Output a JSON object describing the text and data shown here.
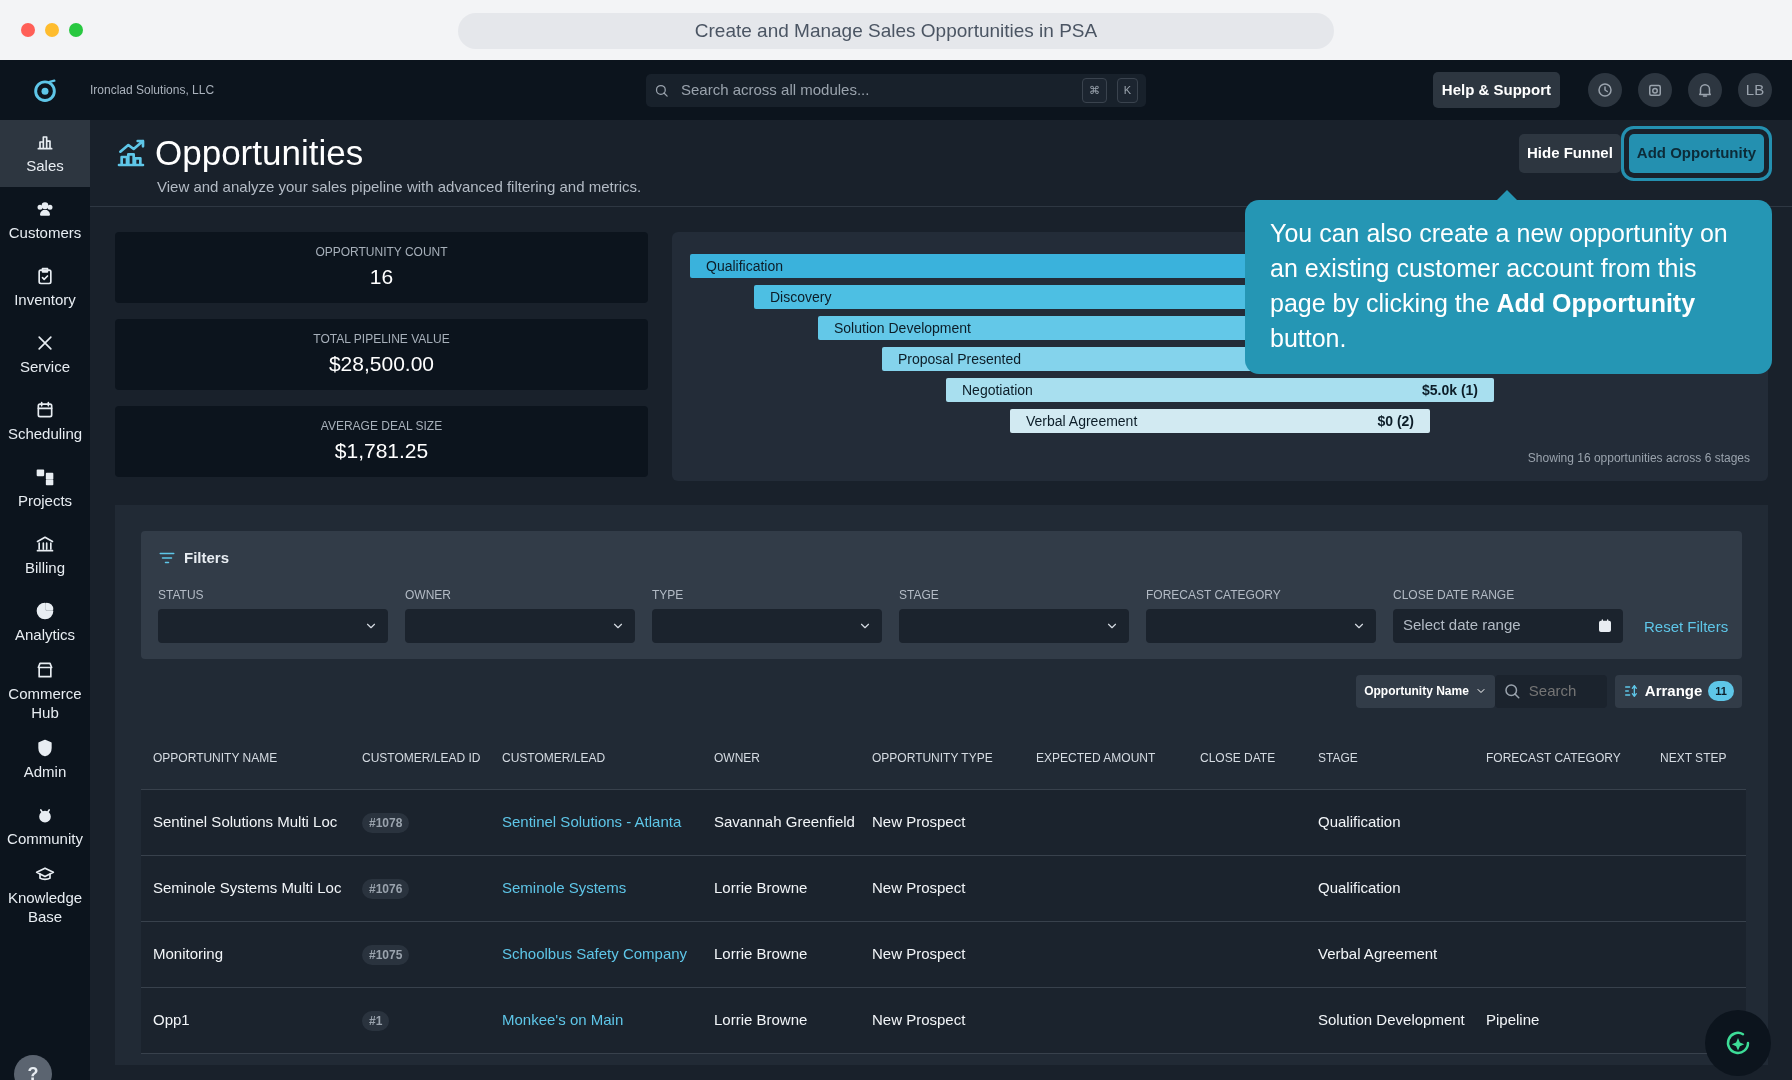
{
  "window": {
    "title": "Create and Manage Sales Opportunities in PSA"
  },
  "topbar": {
    "company": "Ironclad Solutions, LLC",
    "search_placeholder": "Search across all modules...",
    "shortcut_keys": [
      "⌘",
      "K"
    ],
    "help": "Help & Support",
    "avatar": "LB"
  },
  "sidebar": {
    "items": [
      {
        "label": "Sales",
        "selected": true
      },
      {
        "label": "Customers",
        "selected": false
      },
      {
        "label": "Inventory",
        "selected": false
      },
      {
        "label": "Service",
        "selected": false
      },
      {
        "label": "Scheduling",
        "selected": false
      },
      {
        "label": "Projects",
        "selected": false
      },
      {
        "label": "Billing",
        "selected": false
      },
      {
        "label": "Analytics",
        "selected": false
      },
      {
        "label": "Commerce Hub",
        "selected": false
      },
      {
        "label": "Admin",
        "selected": false
      },
      {
        "label": "Community",
        "selected": false
      },
      {
        "label": "Knowledge Base",
        "selected": false
      }
    ],
    "help_button": "?"
  },
  "header": {
    "title": "Opportunities",
    "subtitle": "View and analyze your sales pipeline with advanced filtering and metrics.",
    "buttons": [
      {
        "label": "Hide Funnel",
        "highlighted": false,
        "kind": "secondary"
      },
      {
        "label": "Add Opportunity",
        "highlighted": true,
        "kind": "primary"
      }
    ]
  },
  "stats": [
    {
      "label": "OPPORTUNITY COUNT",
      "value": "16"
    },
    {
      "label": "TOTAL PIPELINE VALUE",
      "value": "$28,500.00"
    },
    {
      "label": "AVERAGE DEAL SIZE",
      "value": "$1,781.25"
    }
  ],
  "funnel": {
    "stages": [
      {
        "label": "Qualification",
        "color": "#3ab2dc"
      },
      {
        "label": "Discovery",
        "color": "#4dbfe3"
      },
      {
        "label": "Solution Development",
        "color": "#63c8e8"
      },
      {
        "label": "Proposal Presented",
        "color": "#84d3ec"
      },
      {
        "label": "Negotiation",
        "value": "$5.0k (1)",
        "color": "#a8dfef"
      },
      {
        "label": "Verbal Agreement",
        "value": "$0 (2)",
        "color": "#d2eaf2"
      }
    ],
    "footer": "Showing 16 opportunities across 6 stages"
  },
  "tooltip": {
    "text": "You can also create a new opportunity on an existing customer account from this page by clicking the **Add Opportunity** button."
  },
  "filters": {
    "title": "Filters",
    "fields": [
      {
        "label": "STATUS",
        "kind": "select"
      },
      {
        "label": "OWNER",
        "kind": "select"
      },
      {
        "label": "TYPE",
        "kind": "select"
      },
      {
        "label": "STAGE",
        "kind": "select"
      },
      {
        "label": "FORECAST CATEGORY",
        "kind": "select"
      },
      {
        "label": "CLOSE DATE RANGE",
        "kind": "date",
        "placeholder": "Select date range"
      }
    ],
    "reset": "Reset Filters"
  },
  "table_toolbar": {
    "sort_field": "Opportunity Name",
    "search_placeholder": "Search",
    "arrange": "Arrange",
    "arrange_count": "11"
  },
  "table": {
    "columns": [
      "OPPORTUNITY NAME",
      "CUSTOMER/LEAD ID",
      "CUSTOMER/LEAD",
      "OWNER",
      "OPPORTUNITY TYPE",
      "EXPECTED AMOUNT",
      "CLOSE DATE",
      "STAGE",
      "FORECAST CATEGORY",
      "NEXT STEP"
    ],
    "rows": [
      {
        "name": "Sentinel Solutions Multi Loc",
        "id": "#1078",
        "customer": "Sentinel Solutions - Atlanta",
        "owner": "Savannah Greenfield",
        "type": "New Prospect",
        "stage": "Qualification"
      },
      {
        "name": "Seminole Systems Multi Loc",
        "id": "#1076",
        "customer": "Seminole Systems",
        "owner": "Lorrie Browne",
        "type": "New Prospect",
        "stage": "Qualification"
      },
      {
        "name": "Monitoring",
        "id": "#1075",
        "customer": "Schoolbus Safety Company",
        "owner": "Lorrie Browne",
        "type": "New Prospect",
        "stage": "Verbal Agreement"
      },
      {
        "name": "Opp1",
        "id": "#1",
        "customer": "Monkee's on Main",
        "owner": "Lorrie Browne",
        "type": "New Prospect",
        "stage": "Solution Development",
        "forecast": "Pipeline"
      }
    ]
  }
}
